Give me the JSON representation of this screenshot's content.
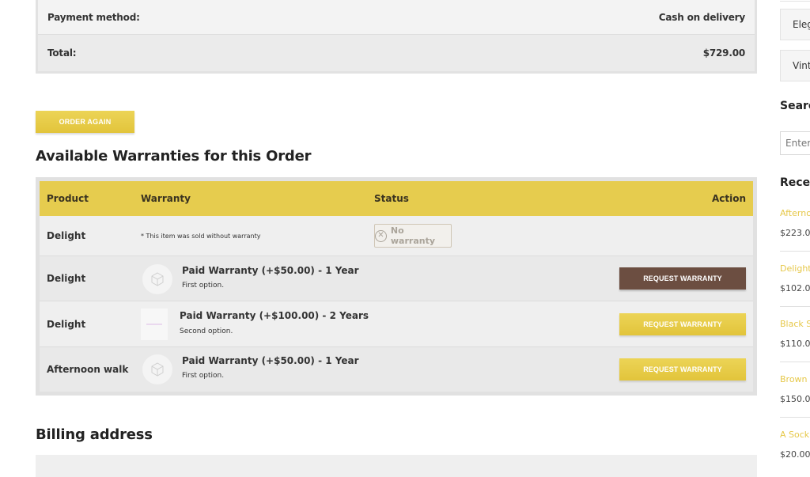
{
  "summary": {
    "payment_label": "Payment method:",
    "payment_value": "Cash on delivery",
    "total_label": "Total:",
    "total_value": "$729.00"
  },
  "order_again_label": "ORDER AGAIN",
  "warranties": {
    "title": "Available Warranties for this Order",
    "headers": {
      "product": "Product",
      "warranty": "Warranty",
      "status": "Status",
      "action": "Action"
    },
    "rows": [
      {
        "product": "Delight",
        "note": "* This item was sold without warranty",
        "status": "No warranty"
      },
      {
        "product": "Delight",
        "warranty_name": "Paid Warranty (+$50.00) - 1 Year",
        "warranty_desc": "First option.",
        "action": "REQUEST WARRANTY"
      },
      {
        "product": "Delight",
        "warranty_name": "Paid Warranty (+$100.00) - 2 Years",
        "warranty_desc": "Second option.",
        "action": "REQUEST WARRANTY"
      },
      {
        "product": "Afternoon walk",
        "warranty_name": "Paid Warranty (+$50.00) - 1 Year",
        "warranty_desc": "First option.",
        "action": "REQUEST WARRANTY"
      }
    ]
  },
  "billing": {
    "title": "Billing address"
  },
  "sidebar": {
    "categories": [
      "Eleg",
      "Vint"
    ],
    "search_title": "Searc",
    "search_placeholder": "Enter",
    "recent_title": "Recen",
    "recent": [
      {
        "name": "Afterno",
        "price": "$223.0"
      },
      {
        "name": "Delight",
        "price": "$102.0"
      },
      {
        "name": "Black S",
        "price": "$110.0"
      },
      {
        "name": "Brown",
        "price": "$150.0"
      },
      {
        "name": "A Sock",
        "price": "$20.00"
      }
    ]
  },
  "colors": {
    "accent_yellow": "#e6cc4e",
    "request_dark": "#6c4e41",
    "link_yellow": "#e6c84a"
  }
}
